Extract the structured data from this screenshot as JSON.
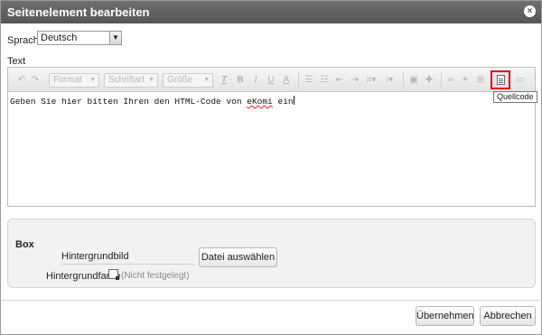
{
  "dialog": {
    "title": "Seitenelement bearbeiten",
    "close_icon": "close-icon"
  },
  "language": {
    "label": "Sprache",
    "selected": "Deutsch"
  },
  "text_section": {
    "label": "Text"
  },
  "toolbar": {
    "format_label": "Format",
    "font_label": "Schriftart",
    "size_label": "Größe",
    "source_tooltip": "Quellcode",
    "icons": [
      "undo-icon",
      "redo-icon",
      "remove-format-icon",
      "bold-icon",
      "italic-icon",
      "underline-icon",
      "text-color-icon",
      "numbered-list-icon",
      "bullet-list-icon",
      "outdent-icon",
      "indent-icon",
      "align-icon",
      "line-height-icon",
      "image-icon",
      "plugin-icon",
      "link-icon",
      "unlink-icon",
      "table-icon",
      "source-icon",
      "maximize-icon"
    ]
  },
  "editor": {
    "content_before": "Geben Sie hier bitten Ihren den HTML-Code von ",
    "content_misspelled": "eKomi",
    "content_after": " ein"
  },
  "box": {
    "title": "Box",
    "background_image_label": "Hintergrundbild",
    "choose_file_label": "Datei auswählen",
    "background_color_label": "Hintergrundfarbe",
    "background_color_value": "(Nicht festgelegt)"
  },
  "footer": {
    "apply_label": "Übernehmen",
    "cancel_label": "Abbrechen"
  },
  "colors": {
    "title_bar": "#5f5f5f",
    "highlight_border": "#e0001b",
    "panel_bg": "#f2f2f2"
  }
}
